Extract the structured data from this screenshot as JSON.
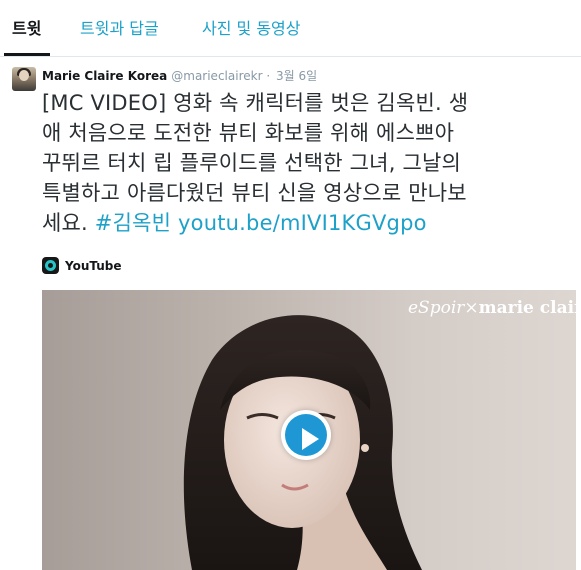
{
  "tabs": [
    {
      "label": "트윗",
      "active": true
    },
    {
      "label": "트윗과 답글",
      "active": false
    },
    {
      "label": "사진 및 동영상",
      "active": false
    }
  ],
  "tweet": {
    "name": "Marie Claire Korea",
    "handle": "@marieclairekr",
    "separator": "·",
    "date": "3월 6일",
    "text_lines": [
      "[MC VIDEO] 영화 속 캐릭터를 벗은 김옥빈. 생",
      "애 처음으로 도전한 뷰티 화보를 위해 에스쁘아",
      "꾸뛰르 터치 립 플루이드를 선택한 그녀, 그날의",
      "특별하고 아름다웠던 뷰티 신을 영상으로 만나보",
      "세요. "
    ],
    "hashtag": "#김옥빈",
    "url": "youtu.be/mIVI1KGVgpo",
    "card": {
      "source": "YouTube",
      "watermark_left": "eSpoir",
      "watermark_sep": "×",
      "watermark_right": "marie claire",
      "play_icon": "play-icon"
    }
  },
  "colors": {
    "link": "#1da1c9",
    "text": "#292f33",
    "muted": "#8899a6",
    "play": "#1f97d4"
  }
}
